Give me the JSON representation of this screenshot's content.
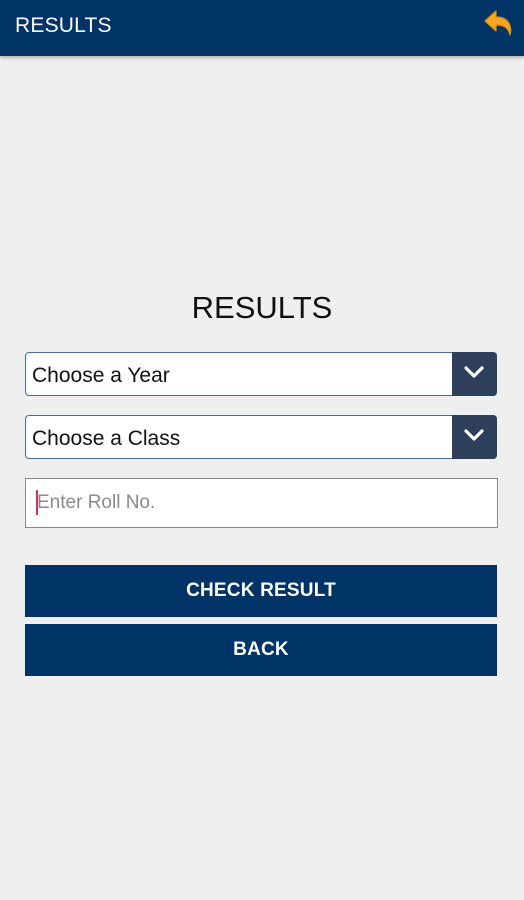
{
  "topbar": {
    "title": "RESULTS",
    "back_icon": "reply-arrow-icon",
    "back_icon_color": "#f5a623",
    "bar_color": "#003366"
  },
  "form": {
    "heading": "RESULTS",
    "year_select": {
      "selected": "Choose a Year",
      "icon": "chevron-down-icon"
    },
    "class_select": {
      "selected": "Choose a Class",
      "icon": "chevron-down-icon"
    },
    "roll_input": {
      "placeholder": "Enter Roll No.",
      "value": ""
    },
    "check_button": "CHECK RESULT",
    "back_button": "BACK"
  }
}
